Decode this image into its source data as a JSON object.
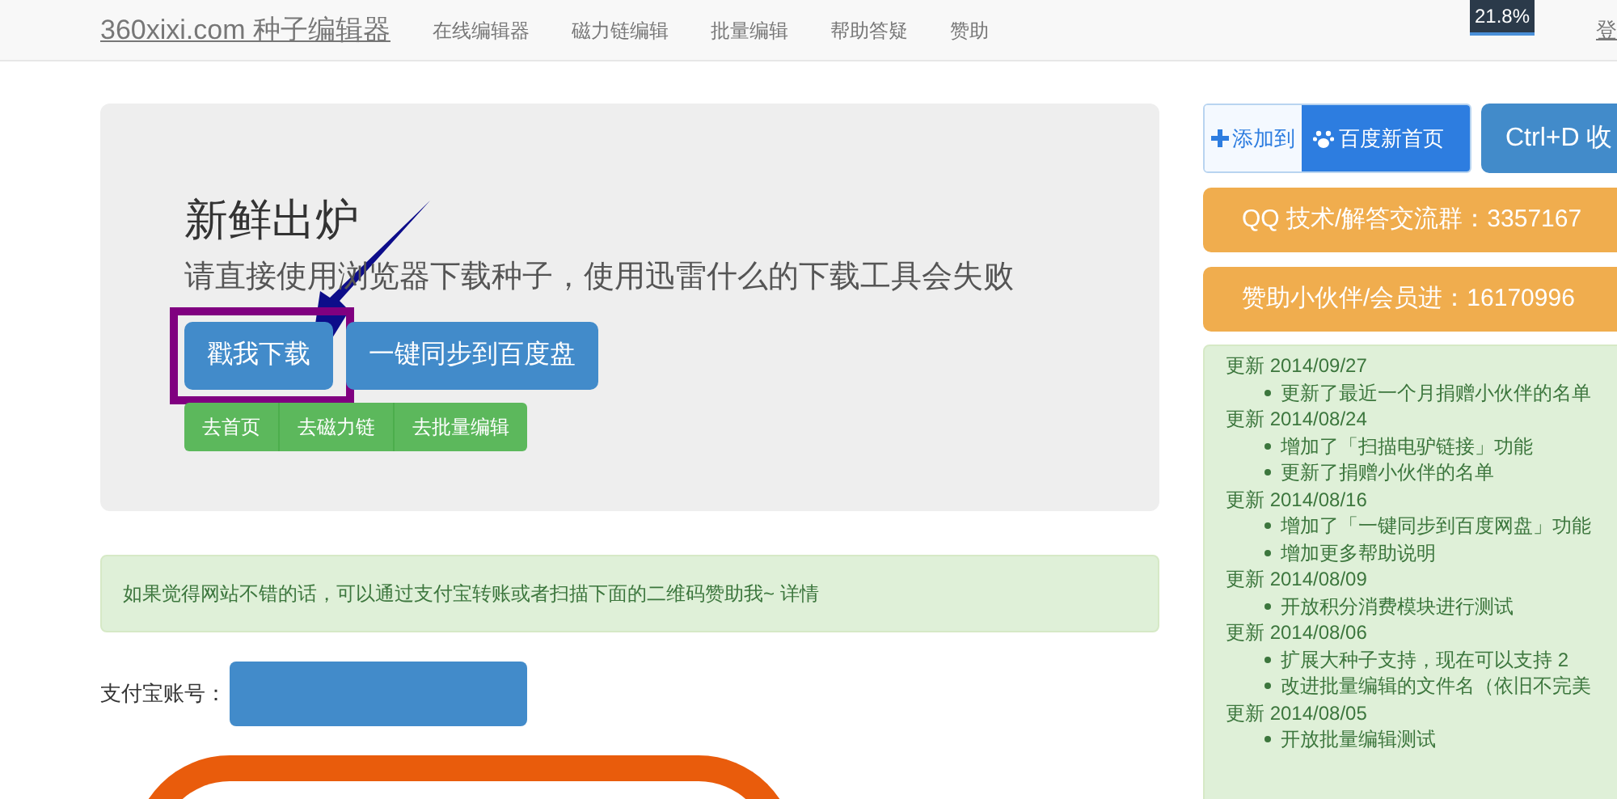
{
  "navbar": {
    "brand": "360xixi.com 种子编辑器",
    "links": [
      {
        "label": "在线编辑器"
      },
      {
        "label": "磁力链编辑"
      },
      {
        "label": "批量编辑"
      },
      {
        "label": "帮助答疑"
      },
      {
        "label": "赞助"
      }
    ],
    "badge": "21.8%",
    "login": "登"
  },
  "hero": {
    "title": "新鲜出炉",
    "subtitle": "请直接使用浏览器下载种子，使用迅雷什么的下载工具会失败",
    "buttons": [
      {
        "label": "戳我下载",
        "highlighted": true
      },
      {
        "label": "一键同步到百度盘",
        "highlighted": false
      }
    ],
    "small_buttons": [
      {
        "label": "去首页"
      },
      {
        "label": "去磁力链"
      },
      {
        "label": "去批量编辑"
      }
    ]
  },
  "notice": {
    "text": "如果觉得网站不错的话，可以通过支付宝转账或者扫描下面的二维码赞助我~",
    "link": "详情"
  },
  "alipay": {
    "label": "支付宝账号："
  },
  "sidebar": {
    "add_to": "添加到",
    "baidu": "百度新首页",
    "bookmark": "Ctrl+D 收",
    "qq": "QQ 技术/解答交流群：3357167",
    "sponsor": "赞助小伙伴/会员进：16170996",
    "updates": [
      {
        "title": "更新 2014/09/27",
        "items": [
          "更新了最近一个月捐赠小伙伴的名单"
        ]
      },
      {
        "title": "更新 2014/08/24",
        "items": [
          "增加了「扫描电驴链接」功能",
          "更新了捐赠小伙伴的名单"
        ]
      },
      {
        "title": "更新 2014/08/16",
        "items": [
          "增加了「一键同步到百度网盘」功能",
          "增加更多帮助说明"
        ]
      },
      {
        "title": "更新 2014/08/09",
        "items": [
          "开放积分消费模块进行测试"
        ]
      },
      {
        "title": "更新 2014/08/06",
        "items": [
          "扩展大种子支持，现在可以支持 2",
          "改进批量编辑的文件名（依旧不完美"
        ]
      },
      {
        "title": "更新 2014/08/05",
        "items": [
          "开放批量编辑测试"
        ]
      }
    ]
  }
}
